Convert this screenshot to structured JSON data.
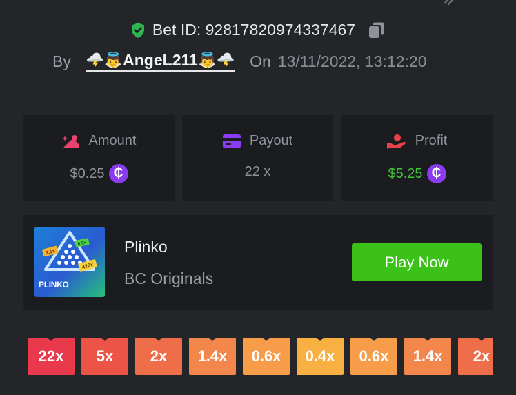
{
  "bet": {
    "id_text": "Bet ID: 92817820974337467",
    "by_label": "By",
    "user_prefix_emoji": "🌩️👼",
    "username": "AngeL211",
    "user_suffix_emoji": "👼🌩️",
    "on_label": "On",
    "datetime": "13/11/2022, 13:12:20"
  },
  "stats": {
    "amount": {
      "label": "Amount",
      "value": "$0.25"
    },
    "payout": {
      "label": "Payout",
      "value": "22 x"
    },
    "profit": {
      "label": "Profit",
      "value": "$5.25"
    },
    "coin_symbol": "₵"
  },
  "game": {
    "name": "Plinko",
    "provider": "BC Originals",
    "thumb_title": "PLINKO",
    "thumb_tags": [
      "2.1×",
      "0.5×",
      "420×"
    ],
    "play_label": "Play Now"
  },
  "multipliers": [
    {
      "label": "22x",
      "color": "#e83a4c"
    },
    {
      "label": "5x",
      "color": "#ec5448"
    },
    {
      "label": "2x",
      "color": "#ef6e4a"
    },
    {
      "label": "1.4x",
      "color": "#f3864b"
    },
    {
      "label": "0.6x",
      "color": "#f79c48"
    },
    {
      "label": "0.4x",
      "color": "#f9b043"
    },
    {
      "label": "0.6x",
      "color": "#f79c48"
    },
    {
      "label": "1.4x",
      "color": "#f3864b"
    },
    {
      "label": "2x",
      "color": "#ef6e4a"
    }
  ],
  "colors": {
    "background": "#232529",
    "panel": "#1b1c1f",
    "accent_green": "#3bc117",
    "profit_green": "#3fc436",
    "coin_purple": "#8a3cf0",
    "amount_icon_pink": "#e8426e",
    "payout_icon_purple": "#8a3cf0",
    "profit_icon_red": "#e8424a",
    "verified_green": "#2fb350"
  },
  "icons": {
    "verified": "shield-check-icon",
    "copy": "copy-icon",
    "amount": "coins-hand-icon",
    "payout": "credit-card-icon",
    "profit": "hand-money-icon",
    "share": "share-icon"
  }
}
